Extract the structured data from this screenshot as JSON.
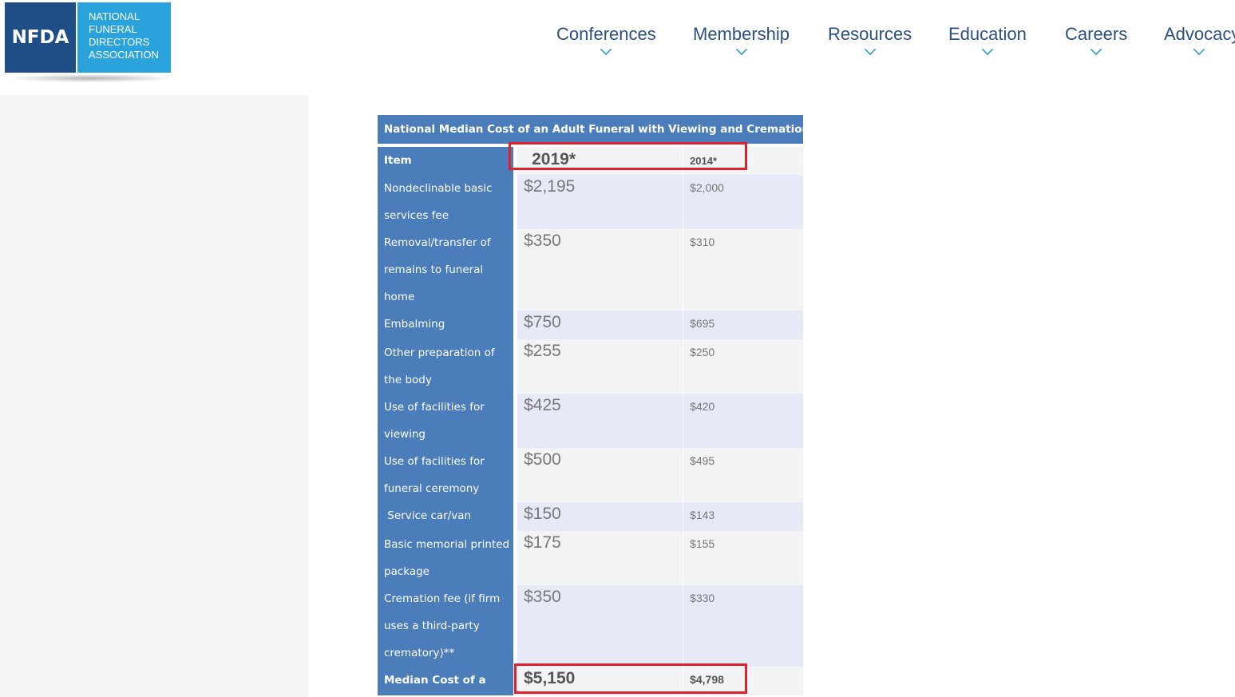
{
  "logo": {
    "abbr": "NFDA",
    "lines": [
      "NATIONAL",
      "FUNERAL",
      "DIRECTORS",
      "ASSOCIATION"
    ],
    "colors": {
      "dark": "#1f4e87",
      "light": "#2aa3dc"
    }
  },
  "nav": {
    "items": [
      {
        "label": "Conferences",
        "icon": "chevron-down-icon"
      },
      {
        "label": "Membership",
        "icon": "chevron-down-icon"
      },
      {
        "label": "Resources",
        "icon": "chevron-down-icon"
      },
      {
        "label": "Education",
        "icon": "chevron-down-icon"
      },
      {
        "label": "Careers",
        "icon": "chevron-down-icon"
      },
      {
        "label": "Advocacy",
        "icon": "chevron-down-icon"
      }
    ]
  },
  "table": {
    "title": "National Median Cost of an Adult Funeral with Viewing and Cremation",
    "header": {
      "item": "Item",
      "y2019": "2019*",
      "y2014": "2014*"
    },
    "rows": [
      {
        "item": "Nondeclinable basic services fee",
        "y2019": "$2,195",
        "y2014": "$2,000"
      },
      {
        "item": "Removal/transfer of remains to funeral home",
        "y2019": "$350",
        "y2014": "$310"
      },
      {
        "item": "Embalming",
        "y2019": "$750",
        "y2014": "$695"
      },
      {
        "item": "Other preparation of the body",
        "y2019": "$255",
        "y2014": "$250"
      },
      {
        "item": "Use of facilities for viewing",
        "y2019": "$425",
        "y2014": "$420"
      },
      {
        "item": "Use of facilities for funeral ceremony",
        "y2019": "$500",
        "y2014": "$495"
      },
      {
        "item": " Service car/van",
        "y2019": "$150",
        "y2014": "$143"
      },
      {
        "item": "Basic memorial printed package",
        "y2019": "$175",
        "y2014": "$155"
      },
      {
        "item": "Cremation fee (if firm uses a third-party crematory)**",
        "y2019": "$350",
        "y2014": "$330"
      }
    ],
    "total": {
      "item": "Median Cost of a",
      "y2019": "$5,150",
      "y2014": "$4,798"
    },
    "colors": {
      "header_blue": "#4a7dba",
      "row_tint": "#e6eaf6",
      "row_plain": "#f2f3f5",
      "highlight": "#e0202a"
    }
  }
}
